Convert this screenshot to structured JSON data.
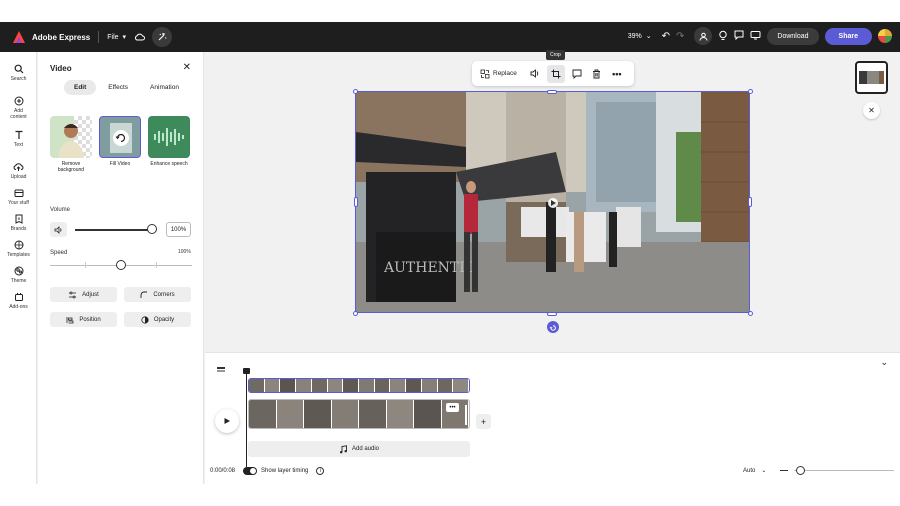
{
  "topbar": {
    "app_name": "Adobe Express",
    "file_label": "File",
    "zoom": "39%",
    "download_label": "Download",
    "share_label": "Share"
  },
  "rail": {
    "items": [
      {
        "label": "Search",
        "icon": "search-icon"
      },
      {
        "label": "Add content",
        "icon": "plus-circle-icon"
      },
      {
        "label": "Text",
        "icon": "text-icon"
      },
      {
        "label": "Upload",
        "icon": "upload-icon"
      },
      {
        "label": "Your stuff",
        "icon": "folder-icon"
      },
      {
        "label": "Brands",
        "icon": "brand-icon"
      },
      {
        "label": "Templates",
        "icon": "templates-icon"
      },
      {
        "label": "Theme",
        "icon": "theme-icon"
      },
      {
        "label": "Add-ons",
        "icon": "addons-icon"
      }
    ]
  },
  "panel": {
    "title": "Video",
    "tabs": [
      "Edit",
      "Effects",
      "Animation"
    ],
    "active_tab": "Edit",
    "cards": [
      {
        "label": "Remove background"
      },
      {
        "label": "Fill Video"
      },
      {
        "label": "Enhance speech"
      }
    ],
    "volume_label": "Volume",
    "volume_value": "100%",
    "volume_level": 1.0,
    "speed_label": "Speed",
    "speed_value": "100%",
    "speed_level": 0.5,
    "buttons": [
      "Adjust",
      "Corners",
      "Position",
      "Opacity"
    ]
  },
  "stage": {
    "tooltip": "Crop",
    "replace_label": "Replace"
  },
  "timeline": {
    "time": "0:00/0:08",
    "show_layer_timing": "Show layer timing",
    "add_audio": "Add audio",
    "auto_label": "Auto"
  },
  "colors": {
    "accent": "#5b5bd6",
    "topbar": "#1e1e1e"
  }
}
